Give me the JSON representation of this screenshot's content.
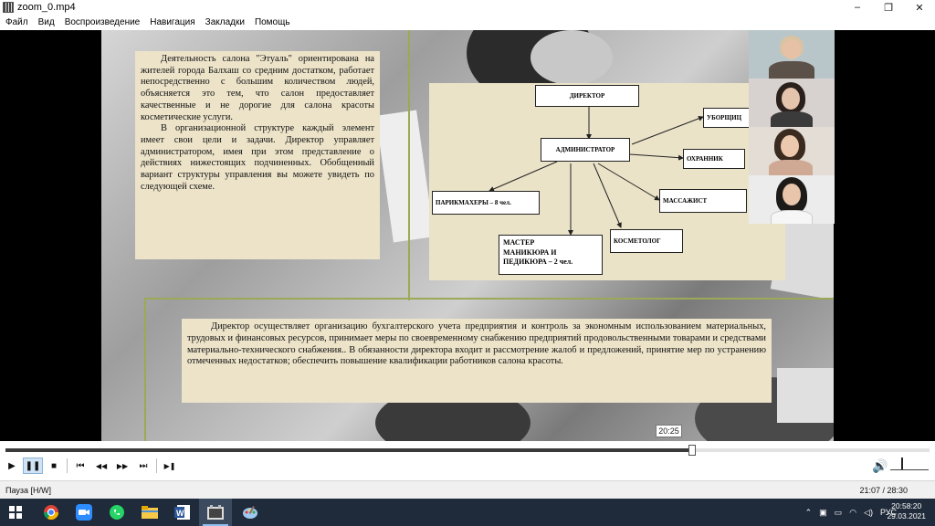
{
  "window": {
    "title": "zoom_0.mp4",
    "minimize": "–",
    "maximize": "❐",
    "close": "✕"
  },
  "menu": [
    "Файл",
    "Вид",
    "Воспроизведение",
    "Навигация",
    "Закладки",
    "Помощь"
  ],
  "slide": {
    "text_left": [
      "Деятельность салона \"Этуаль\" ориентирована на жителей города Балхаш со средним достатком, работает непосредственно с большим количеством людей, объясняется это тем, что салон предоставляет качественные и не дорогие для салона красоты косметические услуги.",
      "В организационной структуре каждый элемент имеет свои цели и задачи. Директор управляет администратором, имея при этом представление о действиях нижестоящих подчиненных. Обобщенный вариант структуры управления вы можете увидеть по следующей схеме."
    ],
    "text_bottom": "Директор осуществляет организацию бухгалтерского учета предприятия и контроль за экономным использованием материальных, трудовых и финансовых ресурсов, принимает меры по своевременному снабжению предприятий продовольственными товарами и средствами материально-технического снабжения.. В обязанности директора входит и рассмотрение жалоб и предложений, принятие мер по устранению отмеченных недостатков; обеспечить повышение квалификации работников салона красоты.",
    "diagram": {
      "director": "ДИРЕКТОР",
      "administrator": "АДМИНИСТРАТОР",
      "cleaner": "УБОРЩИЦ",
      "guard": "ОХРАННИК",
      "hairdressers": "ПАРИКМАХЕРЫ – 8 чел.",
      "masseur": "МАССАЖИСТ",
      "cosmetologist": "КОСМЕТОЛОГ",
      "manicure": [
        "МАСТЕР",
        "МАНИКЮРА И",
        "ПЕДИКЮРА – 2 чел."
      ]
    }
  },
  "seek_tooltip": "20:25",
  "playback": {
    "progress_fraction": 0.743
  },
  "controls": {
    "play": "▶",
    "pause": "❚❚",
    "stop": "■",
    "prev": "⏮",
    "rewind": "◀◀",
    "forward": "▶▶",
    "next": "⏭",
    "frame_step": "▶❚",
    "volume": "🔊"
  },
  "status": {
    "left": "Пауза [H/W]",
    "time": "21:07 / 28:30"
  },
  "taskbar": {
    "tray_lang": "РУС",
    "clock_time": "20:58:20",
    "clock_date": "29.03.2021"
  }
}
